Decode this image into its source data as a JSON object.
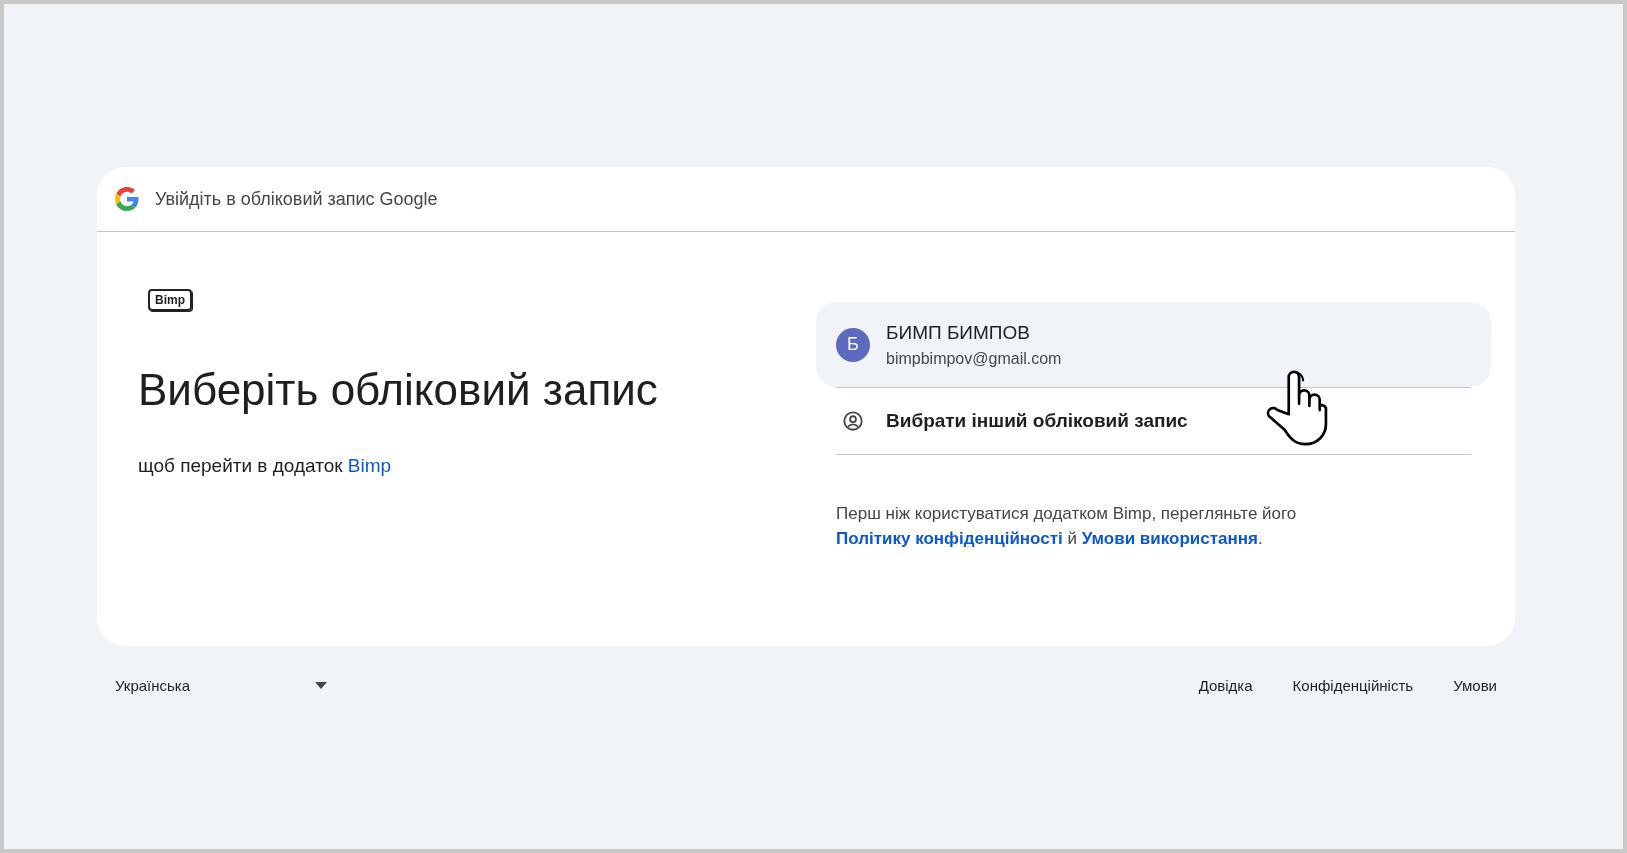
{
  "header": {
    "title": "Увійдіть в обліковий запис Google"
  },
  "app_logo": {
    "text": "Bimp"
  },
  "heading": "Виберіть обліковий запис",
  "subtitle": {
    "text": "щоб перейти в додаток",
    "link": "Bimp"
  },
  "accounts": [
    {
      "kind": "account",
      "avatar": "Б",
      "color": "#5c6bc0",
      "name": "БИМП БИМПОВ",
      "email": "bimpbimpov@gmail.com",
      "hovered": true
    },
    {
      "kind": "other",
      "label": "Вибрати інший обліковий запис",
      "hovered": false
    }
  ],
  "notice": {
    "before": "Перш ніж користуватися додатком Bimp, перегляньте його",
    "link_1": "Політику конфіденційності",
    "middle": "й",
    "link_2": "Умови використання",
    "end": "."
  },
  "footer": {
    "language": "Українська",
    "links": [
      "Довідка",
      "Конфіденційність",
      "Умови"
    ]
  }
}
